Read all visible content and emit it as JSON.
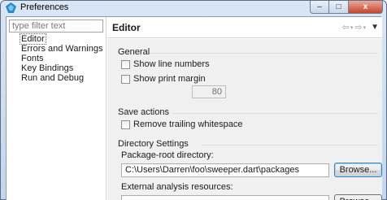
{
  "window": {
    "title": "Preferences",
    "controls": {
      "minimize": "–",
      "maximize": "□",
      "close": "x"
    }
  },
  "filter": {
    "placeholder": "type filter text",
    "value": ""
  },
  "tree": {
    "items": [
      {
        "label": "Editor",
        "selected": true
      },
      {
        "label": "Errors and Warnings",
        "selected": false
      },
      {
        "label": "Fonts",
        "selected": false
      },
      {
        "label": "Key Bindings",
        "selected": false
      },
      {
        "label": "Run and Debug",
        "selected": false
      }
    ]
  },
  "header": {
    "title": "Editor",
    "back_icon": "⇦",
    "forward_icon": "⇨",
    "dropdown_icon": "▾",
    "menu_icon": "▼"
  },
  "general": {
    "title": "General",
    "show_line_numbers": {
      "label": "Show line numbers",
      "checked": false
    },
    "show_print_margin": {
      "label": "Show print margin",
      "checked": false
    },
    "print_margin_value": "80"
  },
  "save_actions": {
    "title": "Save actions",
    "remove_trailing_whitespace": {
      "label": "Remove trailing whitespace",
      "checked": false
    }
  },
  "directory_settings": {
    "title": "Directory Settings",
    "package_root_label": "Package-root directory:",
    "package_root_value": "C:\\Users\\Darren\\foo\\sweeper.dart\\packages",
    "external_label": "External analysis resources:",
    "external_value": "",
    "browse_label": "Browse..."
  },
  "colors": {
    "title_bar": "#c3d6ec",
    "content_bg": "#f0f0f0",
    "close_button": "#c7452c"
  }
}
